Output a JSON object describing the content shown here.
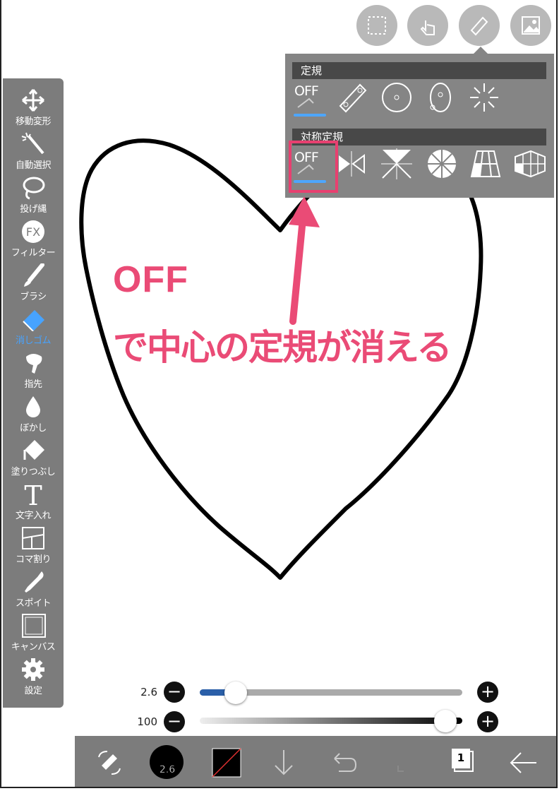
{
  "toolbar": {
    "items": [
      {
        "label": "移動変形",
        "icon": "move-arrows-icon"
      },
      {
        "label": "自動選択",
        "icon": "magic-wand-icon"
      },
      {
        "label": "投げ縄",
        "icon": "lasso-icon"
      },
      {
        "label": "フィルター",
        "icon": "fx-icon",
        "glyph": "FX"
      },
      {
        "label": "ブラシ",
        "icon": "brush-icon"
      },
      {
        "label": "消しゴム",
        "icon": "eraser-icon",
        "active": true
      },
      {
        "label": "指先",
        "icon": "finger-icon"
      },
      {
        "label": "ぼかし",
        "icon": "drop-icon"
      },
      {
        "label": "塗りつぶし",
        "icon": "bucket-icon"
      },
      {
        "label": "文字入れ",
        "icon": "text-icon",
        "glyph": "T"
      },
      {
        "label": "コマ割り",
        "icon": "frame-divide-icon"
      },
      {
        "label": "スポイト",
        "icon": "eyedropper-icon"
      },
      {
        "label": "キャンバス",
        "icon": "canvas-icon"
      },
      {
        "label": "設定",
        "icon": "gear-icon"
      }
    ],
    "active_color": "#47a3ff"
  },
  "top_buttons": [
    "selection-icon",
    "hand-touch-icon",
    "ruler-icon",
    "image-icon"
  ],
  "ruler_panel": {
    "section1_title": "定規",
    "section2_title": "対称定規",
    "off_label": "OFF",
    "section1_items": [
      "off-ruler-icon",
      "line-ruler-icon",
      "circle-ruler-icon",
      "ellipse-ruler-icon",
      "radial-ruler-icon"
    ],
    "section2_items": [
      "off-symmetry-icon",
      "mirror-symmetry-icon",
      "kaleido-symmetry-icon",
      "rotation-symmetry-icon",
      "perspective-1pt-icon",
      "perspective-2pt-icon"
    ]
  },
  "annotation": {
    "line1": "OFF",
    "line2": "で中心の定規が消える",
    "color": "#ea4b76"
  },
  "sliders": {
    "size_value": "2.6",
    "size_fraction": 0.09,
    "opacity_value": "100",
    "opacity_fraction": 1.0,
    "minus": "−",
    "plus": "+"
  },
  "bottom_bar": {
    "brush_size": "2.6",
    "layer_count": "1",
    "icons": [
      "brush-switch-icon",
      "brush-size-icon",
      "color-swatch-icon",
      "download-icon",
      "undo-icon",
      "redo-icon",
      "layers-icon",
      "back-arrow-icon"
    ]
  }
}
